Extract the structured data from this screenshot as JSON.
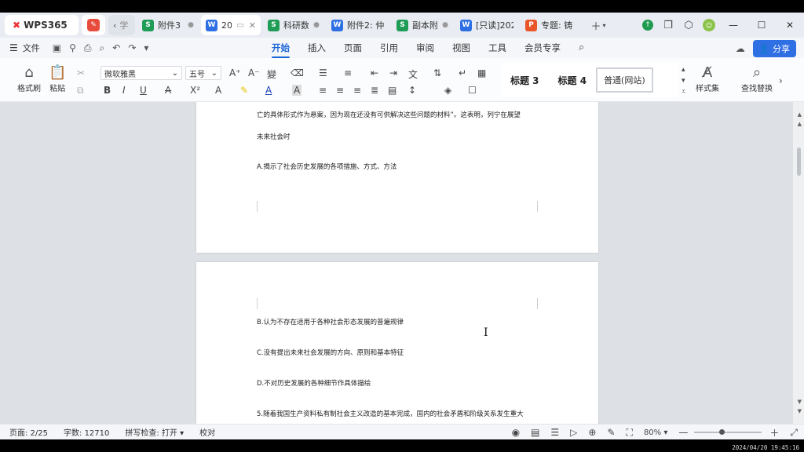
{
  "titlebar": {
    "logo": "WPS365",
    "tabs": [
      {
        "badge": "S",
        "label": "附件3",
        "active": false
      },
      {
        "badge": "W",
        "label": "20",
        "active": true
      },
      {
        "badge": "S",
        "label": "科研数",
        "active": false
      },
      {
        "badge": "W",
        "label": "附件2: 仲",
        "active": false
      },
      {
        "badge": "S",
        "label": "副本附",
        "active": false
      },
      {
        "badge": "W",
        "label": "[只读]202",
        "active": false
      },
      {
        "badge": "P",
        "label": "专题: 铸",
        "active": false
      }
    ],
    "nav_label": "学"
  },
  "menu": {
    "file": "文件",
    "tabs": [
      "开始",
      "插入",
      "页面",
      "引用",
      "审阅",
      "视图",
      "工具",
      "会员专享"
    ],
    "active_tab": "开始",
    "share": "分享"
  },
  "ribbon": {
    "format_painter": "格式刷",
    "paste": "粘贴",
    "font_name": "微软雅黑",
    "font_size": "五号",
    "style_h3": "标题 3",
    "style_h4": "标题 4",
    "style_normal": "普通(网站)",
    "style_set": "样式集",
    "find_replace": "查找替换"
  },
  "document": {
    "page1_lines": [
      "亡的具体形式作为悬案，因为现在还没有可供解决这些问题的材料”。这表明，列宁在展望",
      "未来社会时",
      "A.揭示了社会历史发展的各项措施、方式、方法"
    ],
    "page2_lines": [
      "B.认为不存在适用于各种社会形态发展的普遍规律",
      "C.没有提出未来社会发展的方向、原则和基本特征",
      "D.不对历史发展的各种细节作具体描绘",
      "5.随着我国生产资料私有制社会主义改造的基本完成，国内的社会矛盾和阶级关系发生重大"
    ]
  },
  "status": {
    "page": "页面: 2/25",
    "words": "字数: 12710",
    "spell": "拼写检查: 打开",
    "proof": "校对",
    "zoom": "80%",
    "zoom_level": 0.4
  },
  "timestamp": "2024/04/20 19:45:16",
  "colors": {
    "accent": "#1a66d8",
    "share": "#2f6fe4",
    "sheet": "#1f9d57",
    "word": "#2f6fe4",
    "ppt": "#e8562a"
  }
}
